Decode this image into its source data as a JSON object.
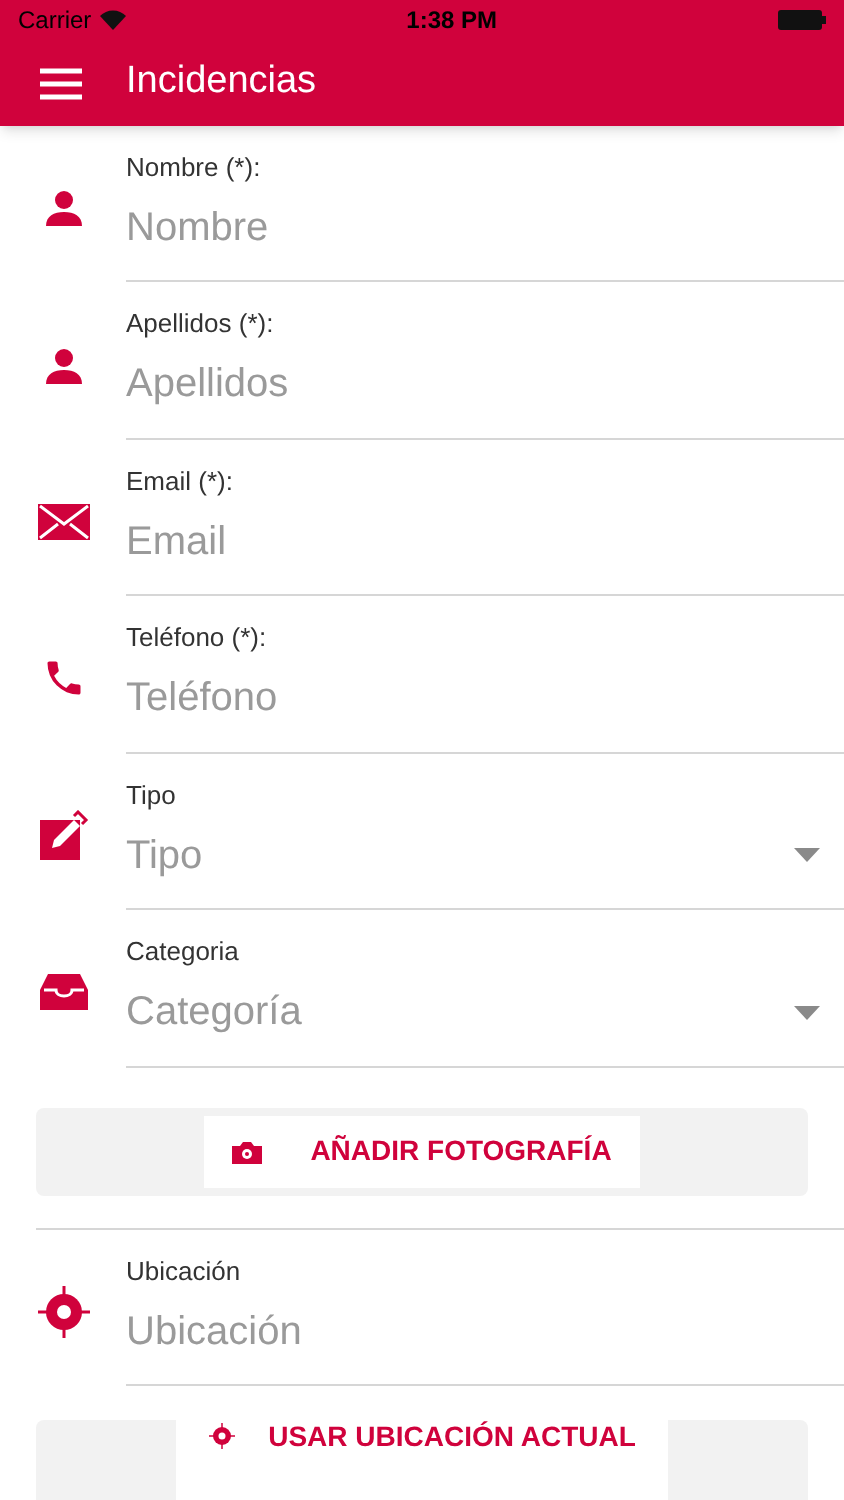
{
  "status_bar": {
    "carrier": "Carrier",
    "time": "1:38 PM"
  },
  "app_bar": {
    "title": "Incidencias"
  },
  "fields": [
    {
      "kind": "text",
      "label": "Nombre (*):",
      "placeholder": "Nombre"
    },
    {
      "kind": "text",
      "label": "Apellidos (*):",
      "placeholder": "Apellidos"
    },
    {
      "kind": "text",
      "label": "Email (*):",
      "placeholder": "Email"
    },
    {
      "kind": "text",
      "label": "Teléfono (*):",
      "placeholder": "Teléfono"
    },
    {
      "kind": "select",
      "label": "Tipo",
      "placeholder": "Tipo"
    },
    {
      "kind": "select",
      "label": "Categoria",
      "placeholder": "Categoría"
    }
  ],
  "photo_button": "AÑADIR FOTOGRAFÍA",
  "location_field": {
    "label": "Ubicación",
    "placeholder": "Ubicación"
  },
  "location_button": "USAR UBICACIÓN ACTUAL"
}
